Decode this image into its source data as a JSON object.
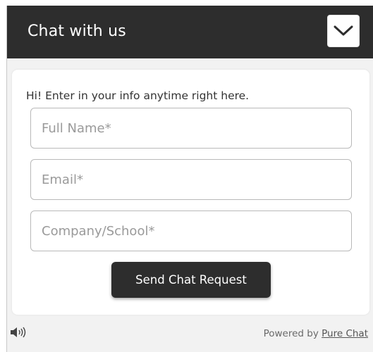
{
  "header": {
    "title": "Chat with us",
    "collapse_icon": "chevron-down-icon"
  },
  "form": {
    "intro": "Hi! Enter in your info anytime right here.",
    "full_name": {
      "placeholder": "Full Name*",
      "value": ""
    },
    "email": {
      "placeholder": "Email*",
      "value": ""
    },
    "company": {
      "placeholder": "Company/School*",
      "value": ""
    },
    "submit_label": "Send Chat Request"
  },
  "footer": {
    "sound_icon": "speaker-icon",
    "powered_prefix": "Powered by",
    "powered_link": "Pure Chat"
  },
  "colors": {
    "header_bg": "#2d2d2d",
    "button_bg": "#2d2d2d",
    "panel_bg": "#f2f2f2",
    "card_bg": "#ffffff",
    "input_border": "#b9b9b9"
  }
}
